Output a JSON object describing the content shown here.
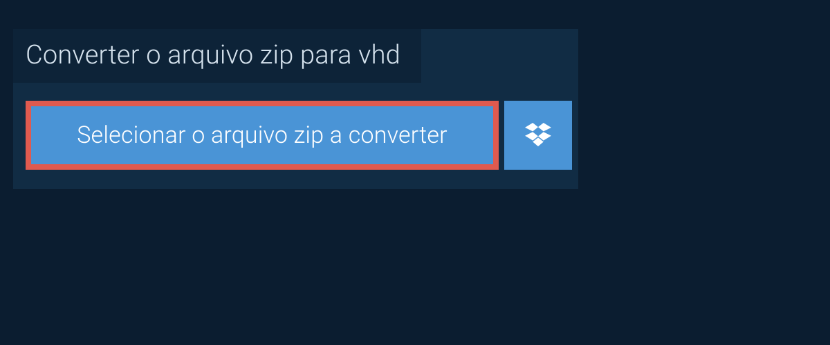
{
  "header": {
    "title": "Converter o arquivo zip para vhd"
  },
  "actions": {
    "select_file_label": "Selecionar o arquivo zip a converter"
  },
  "colors": {
    "page_bg": "#0b1d30",
    "panel_bg": "#112c44",
    "header_bg": "#0d2338",
    "button_bg": "#4a94d6",
    "highlight_border": "#e05a4f",
    "text_light": "#d6e3ee",
    "text_white": "#ffffff"
  }
}
